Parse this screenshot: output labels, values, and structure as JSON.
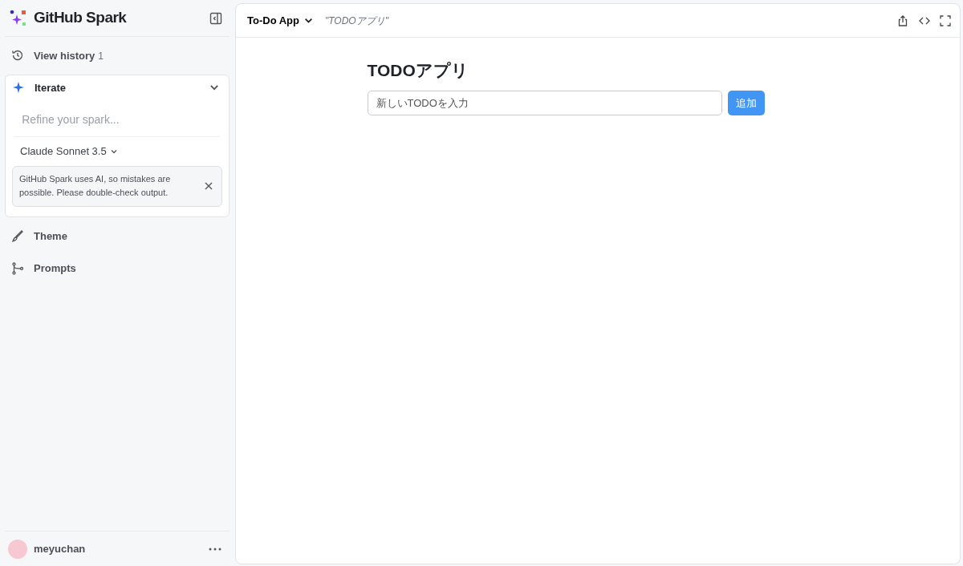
{
  "sidebar": {
    "brand": "GitHub Spark",
    "history": {
      "label": "View history",
      "count": "1"
    },
    "iterate": {
      "label": "Iterate",
      "expanded": true,
      "placeholder": "Refine your spark...",
      "model": "Claude Sonnet 3.5",
      "notice": "GitHub Spark uses AI, so mistakes are possible. Please double-check output."
    },
    "items": [
      {
        "label": "Theme",
        "kind": "brush"
      },
      {
        "label": "Prompts",
        "kind": "branch"
      }
    ],
    "user": {
      "name": "meyuchan"
    }
  },
  "toolbar": {
    "app": "To-Do App",
    "prompt": "\"TODOアプリ\""
  },
  "app": {
    "title": "TODOアプリ",
    "input": {
      "placeholder": "新しいTODOを入力"
    },
    "button": "追加"
  }
}
